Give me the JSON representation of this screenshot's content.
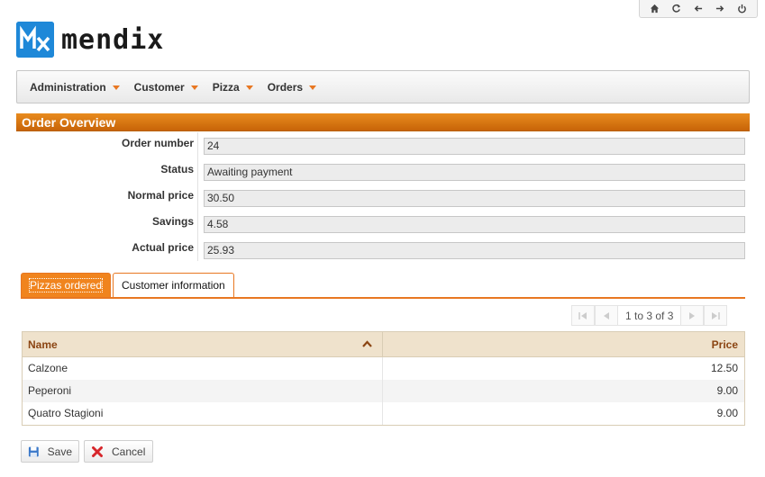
{
  "toolbar": {
    "icons": [
      "home-icon",
      "refresh-icon",
      "back-icon",
      "forward-icon",
      "power-icon"
    ]
  },
  "logo": {
    "text": "mendix",
    "mark_color": "#1e88d8"
  },
  "menu": {
    "items": [
      {
        "label": "Administration"
      },
      {
        "label": "Customer"
      },
      {
        "label": "Pizza"
      },
      {
        "label": "Orders"
      }
    ]
  },
  "section": {
    "title": "Order Overview"
  },
  "form": {
    "fields": [
      {
        "label": "Order number",
        "value": "24"
      },
      {
        "label": "Status",
        "value": "Awaiting payment"
      },
      {
        "label": "Normal price",
        "value": "30.50"
      },
      {
        "label": "Savings",
        "value": "4.58"
      },
      {
        "label": "Actual price",
        "value": "25.93"
      }
    ]
  },
  "tabs": {
    "active": "Pizzas ordered",
    "inactive": "Customer information"
  },
  "paging": {
    "text": "1 to 3 of 3"
  },
  "grid": {
    "columns": {
      "name": "Name",
      "price": "Price"
    },
    "rows": [
      {
        "name": "Calzone",
        "price": "12.50"
      },
      {
        "name": "Peperoni",
        "price": "9.00"
      },
      {
        "name": "Quatro Stagioni",
        "price": "9.00"
      }
    ]
  },
  "buttons": {
    "save": "Save",
    "cancel": "Cancel"
  },
  "colors": {
    "accent": "#e87722",
    "header_bg": "#efe2cc",
    "header_text": "#8b4513"
  }
}
